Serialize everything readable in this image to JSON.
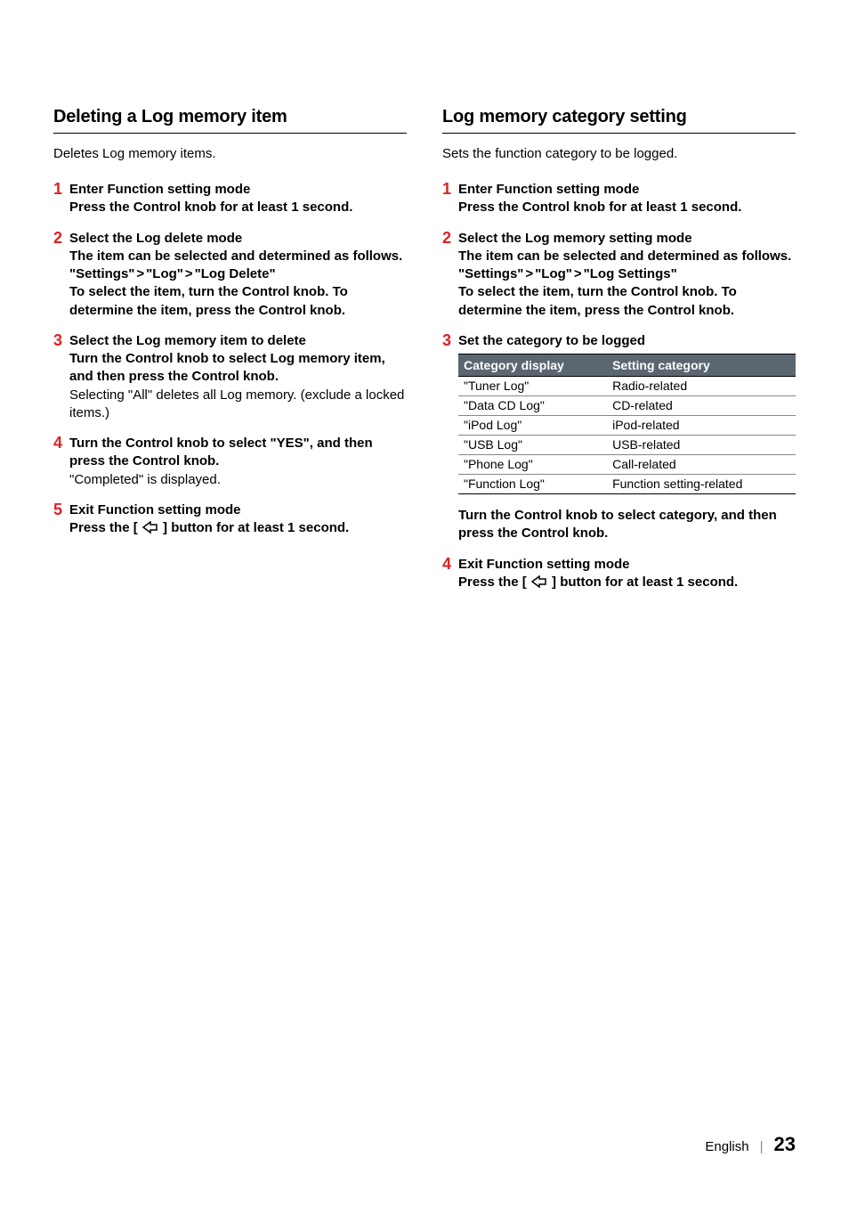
{
  "left": {
    "title": "Deleting a Log memory item",
    "intro": "Deletes Log memory items.",
    "steps": [
      {
        "num": "1",
        "head": "Enter Function setting mode",
        "sub": "Press the Control knob for at least 1 second."
      },
      {
        "num": "2",
        "head": "Select the Log delete mode",
        "sub": "The item can be selected and determined as follows.",
        "path_parts": [
          "\"Settings\"",
          "\"Log\"",
          "\"Log Delete\""
        ],
        "tail": "To select the item, turn the Control knob. To determine the item, press the Control knob."
      },
      {
        "num": "3",
        "head": "Select the Log memory item to delete",
        "sub": "Turn the Control knob to select Log memory item, and then press the Control knob.",
        "note": "Selecting \"All\" deletes all Log memory. (exclude a locked items.)"
      },
      {
        "num": "4",
        "head": "Turn the Control knob to select \"YES\", and then press the Control knob.",
        "note": "\"Completed\" is displayed."
      },
      {
        "num": "5",
        "head": "Exit Function setting mode",
        "back_prefix": "Press the [ ",
        "back_suffix": " ] button for at least 1 second."
      }
    ]
  },
  "right": {
    "title": "Log memory category setting",
    "intro": "Sets the function category to be logged.",
    "steps": [
      {
        "num": "1",
        "head": "Enter Function setting mode",
        "sub": "Press the Control knob for at least 1 second."
      },
      {
        "num": "2",
        "head": "Select the Log memory setting mode",
        "sub": "The item can be selected and determined as follows.",
        "path_parts": [
          "\"Settings\"",
          "\"Log\"",
          "\"Log Settings\""
        ],
        "tail": "To select the item, turn the Control knob. To determine the item, press the Control knob."
      },
      {
        "num": "3",
        "head": "Set the category to be logged"
      }
    ],
    "table": {
      "headers": [
        "Category display",
        "Setting category"
      ],
      "rows": [
        [
          "\"Tuner Log\"",
          "Radio-related"
        ],
        [
          "\"Data CD Log\"",
          "CD-related"
        ],
        [
          "\"iPod Log\"",
          "iPod-related"
        ],
        [
          "\"USB Log\"",
          "USB-related"
        ],
        [
          "\"Phone Log\"",
          "Call-related"
        ],
        [
          "\"Function Log\"",
          "Function setting-related"
        ]
      ]
    },
    "after_table_sub": "Turn the Control knob to select category, and then press the Control knob.",
    "step4": {
      "num": "4",
      "head": "Exit Function setting mode",
      "back_prefix": "Press the [ ",
      "back_suffix": " ] button for at least 1 second."
    }
  },
  "footer": {
    "lang": "English",
    "divider": "|",
    "page": "23"
  },
  "gt": ">"
}
